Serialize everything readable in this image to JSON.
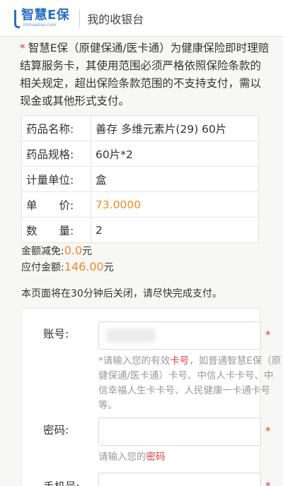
{
  "header": {
    "logo_title": "智慧E保",
    "logo_sub": "zhihuiebao.com",
    "title": "我的收银台"
  },
  "notice": {
    "star": "*",
    "text": "智慧E保（原健保通/医卡通）为健康保险即时理赔结算服务卡，其使用范围必须严格依照保险条款的相关规定，超出保险条款范围的不支持支付，需以现金或其他形式支付。"
  },
  "drug": {
    "rows": [
      {
        "label": "药品名称:",
        "value": "善存 多维元素片(29) 60片"
      },
      {
        "label": "药品规格:",
        "value": "60片*2"
      },
      {
        "label": "计量单位:",
        "value": "盒"
      },
      {
        "label": "单　　价:",
        "value": "73.0000"
      },
      {
        "label": "数　　量:",
        "value": "2"
      }
    ]
  },
  "amounts": {
    "discount_label": "金额减免:",
    "discount_value": "0.0",
    "payable_label": "应付金额:",
    "payable_value": "146.00",
    "unit": "元"
  },
  "close_note": "本页面将在30分钟后关闭，请尽快完成支付。",
  "form": {
    "account_label": "账号:",
    "account_hint_prefix": "*请输入您的有效",
    "account_hint_key": "卡号",
    "account_hint_rest": "，如普通智慧E保（原健保通/医卡通）卡号、中信人卡卡号、中信幸福人生卡卡号、人民健康一卡通卡号等。",
    "password_label": "密码:",
    "password_hint_prefix": "请输入您的",
    "password_hint_key": "密码",
    "phone_label": "手机号:",
    "required_mark": "*"
  },
  "colors": {
    "brand": "#2a6fc4",
    "accent": "#f08a24",
    "required": "#e23b3b"
  }
}
